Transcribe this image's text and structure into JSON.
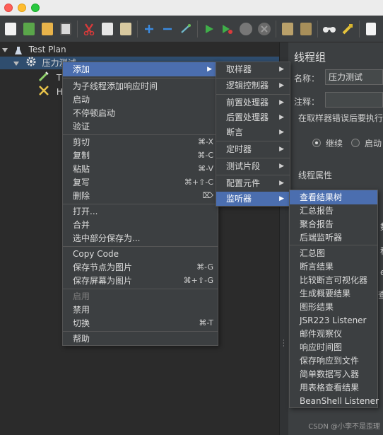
{
  "toolbar": {
    "icons": [
      "new-icon",
      "templates-icon",
      "open-icon",
      "save-icon",
      "cut-icon",
      "copy-icon",
      "paste-icon",
      "expand-icon",
      "collapse-icon",
      "toggle-icon",
      "start-icon",
      "start-no-pause-icon",
      "stop-icon",
      "shutdown-icon",
      "clear-icon",
      "clear-all-icon",
      "search-icon",
      "reset-search-icon",
      "function-helper-icon"
    ]
  },
  "tree": {
    "root_label": "Test Plan",
    "thread_group_label": "压力测试",
    "child1_label": "T",
    "child2_label": "H"
  },
  "context_menu": {
    "add": "添加",
    "add_think_time": "为子线程添加响应时间",
    "start": "启动",
    "start_no_pause": "不停顿启动",
    "validate": "验证",
    "cut": "剪切",
    "cut_sc": "⌘-X",
    "copy": "复制",
    "copy_sc": "⌘-C",
    "paste": "粘贴",
    "paste_sc": "⌘-V",
    "duplicate": "复写",
    "duplicate_sc": "⌘+⇧-C",
    "delete": "删除",
    "delete_sc": "⌦",
    "open": "打开...",
    "merge": "合并",
    "save_selection": "选中部分保存为...",
    "copy_code": "Copy Code",
    "save_node_img": "保存节点为图片",
    "save_node_img_sc": "⌘-G",
    "save_screen_img": "保存屏幕为图片",
    "save_screen_img_sc": "⌘+⇧-G",
    "enable": "启用",
    "disable": "禁用",
    "toggle": "切换",
    "toggle_sc": "⌘-T",
    "help": "帮助"
  },
  "add_submenu": {
    "items": [
      "取样器",
      "逻辑控制器",
      "前置处理器",
      "后置处理器",
      "断言",
      "定时器",
      "测试片段",
      "配置元件",
      "监听器"
    ]
  },
  "listener_submenu": {
    "items": [
      "查看结果树",
      "汇总报告",
      "聚合报告",
      "后端监听器",
      "汇总图",
      "断言结果",
      "比较断言可视化器",
      "生成概要结果",
      "图形结果",
      "JSR223 Listener",
      "邮件观察仪",
      "响应时间图",
      "保存响应到文件",
      "简单数据写入器",
      "用表格查看结果",
      "BeanShell Listener"
    ]
  },
  "right_panel": {
    "title": "线程组",
    "name_label": "名称：",
    "name_value": "压力测试",
    "comment_label": "注释：",
    "sampler_error_label": "在取样器错误后要执行",
    "continue_label": "继续",
    "start_next_label": "启动",
    "thread_props_label": "线程属性",
    "cut_off": [
      "数",
      "a",
      "秒",
      "e",
      "查"
    ]
  },
  "watermark": "CSDN @小李不是歪理",
  "colors": {
    "highlight": "#4b6eaf",
    "tree_selection": "#2f4d6e",
    "panel_bg": "#3c3f41"
  }
}
